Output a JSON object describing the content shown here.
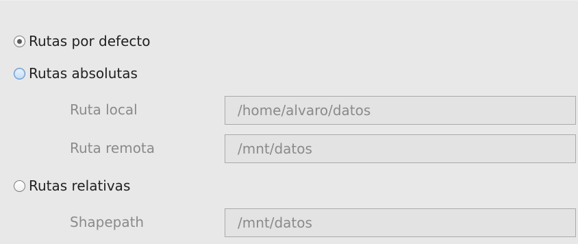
{
  "path_mode": {
    "options": [
      {
        "label": "Rutas por defecto",
        "selected": true
      },
      {
        "label": "Rutas absolutas",
        "selected": false
      },
      {
        "label": "Rutas relativas",
        "selected": false
      }
    ]
  },
  "absolute": {
    "local_label": "Ruta local",
    "local_value": "/home/alvaro/datos",
    "remote_label": "Ruta remota",
    "remote_value": "/mnt/datos"
  },
  "relative": {
    "shapepath_label": "Shapepath",
    "shapepath_value": "/mnt/datos"
  }
}
